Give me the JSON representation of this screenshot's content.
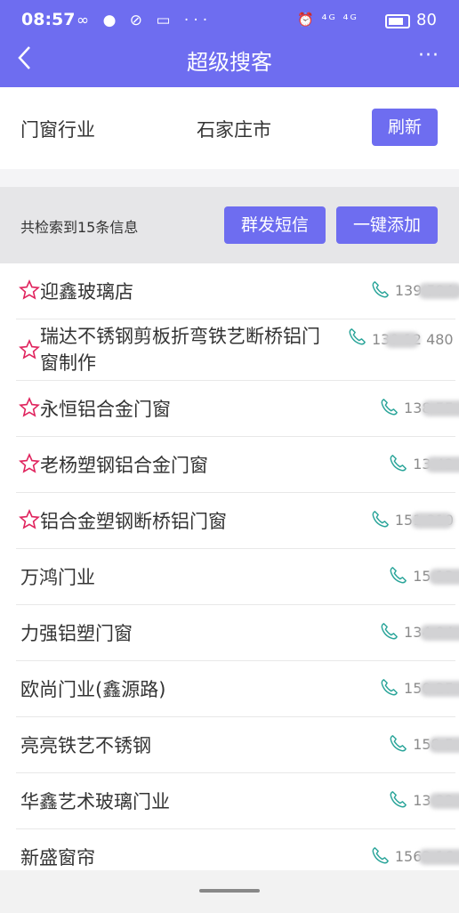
{
  "status": {
    "time": "08:57",
    "left_icons": "∞ ● ⊘ ▭ ···",
    "right_icons": "⏰ ⁴ᴳ ⁴ᴳ",
    "battery": "80"
  },
  "header": {
    "title": "超级搜客",
    "more": "···"
  },
  "filter": {
    "industry": "门窗行业",
    "city": "石家庄市",
    "refresh_label": "刷新"
  },
  "results": {
    "count_text": "共检索到15条信息",
    "sms_label": "群发短信",
    "add_all_label": "一键添加"
  },
  "colors": {
    "accent": "#6e6df0",
    "star": "#e0245e",
    "phone_icon": "#2ba59a"
  },
  "items": [
    {
      "name": "迎鑫玻璃店",
      "phone": "139      594",
      "favorite": true
    },
    {
      "name": "瑞达不锈钢剪板折弯铁艺断桥铝门窗制作",
      "phone": "130    12 480",
      "favorite": true
    },
    {
      "name": "永恒铝合金门窗",
      "phone": "138       55",
      "favorite": true
    },
    {
      "name": "老杨塑钢铝合金门窗",
      "phone": "13       42",
      "favorite": true
    },
    {
      "name": "铝合金塑钢断桥铝门窗",
      "phone": "151      310",
      "favorite": true
    },
    {
      "name": "万鸿门业",
      "phone": "15        13",
      "favorite": false
    },
    {
      "name": "力强铝塑门窗",
      "phone": "134       04",
      "favorite": false
    },
    {
      "name": "欧尚门业(鑫源路)",
      "phone": "150       25",
      "favorite": false
    },
    {
      "name": "亮亮铁艺不锈钢",
      "phone": "158       5",
      "favorite": false
    },
    {
      "name": "华鑫艺术玻璃门业",
      "phone": "13        22",
      "favorite": false
    },
    {
      "name": "新盛窗帘",
      "phone": "1563       16",
      "favorite": false
    }
  ]
}
